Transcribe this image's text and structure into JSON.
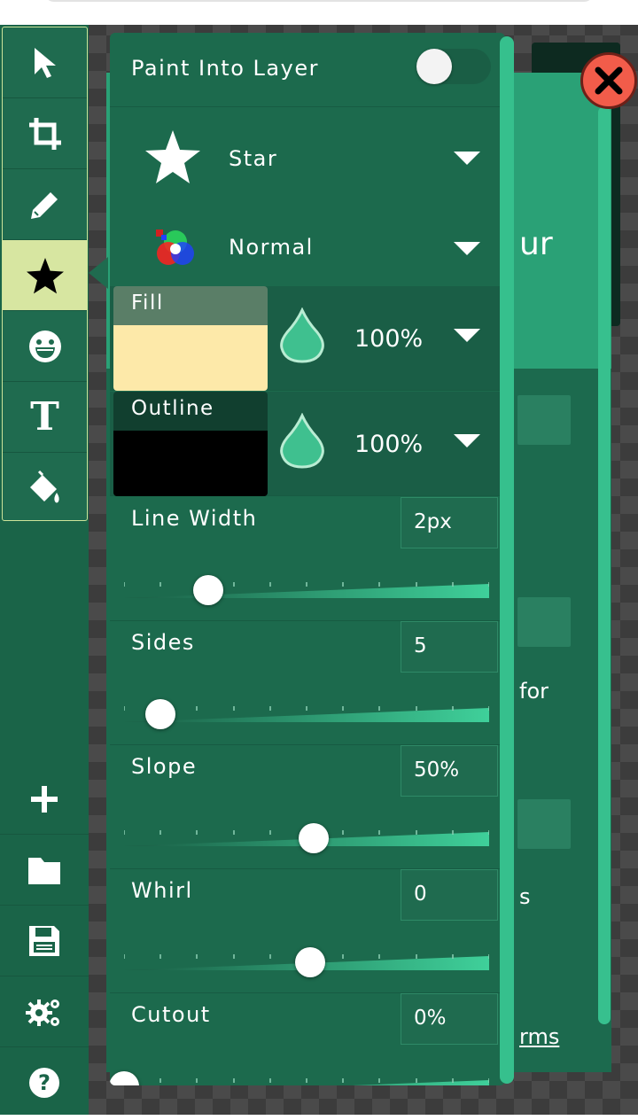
{
  "toolbar": {
    "tools": [
      {
        "icon": "select-arrow-icon"
      },
      {
        "icon": "crop-icon"
      },
      {
        "icon": "pencil-icon"
      },
      {
        "icon": "star-icon",
        "active": true
      },
      {
        "icon": "emoji-icon"
      },
      {
        "icon": "text-icon",
        "glyph": "T"
      },
      {
        "icon": "paint-bucket-icon"
      }
    ],
    "bottom": [
      {
        "icon": "add-icon"
      },
      {
        "icon": "folder-icon"
      },
      {
        "icon": "save-icon"
      },
      {
        "icon": "settings-icon"
      },
      {
        "icon": "help-icon",
        "glyph": "?"
      }
    ]
  },
  "panel": {
    "paint_into_layer": {
      "label": "Paint Into Layer",
      "enabled": false
    },
    "shape": {
      "label": "Star",
      "icon": "star-icon"
    },
    "blend_mode": {
      "label": "Normal",
      "icon": "color-blend-icon"
    },
    "fill": {
      "label": "Fill",
      "color": "#fde9a9",
      "opacity": "100%"
    },
    "outline": {
      "label": "Outline",
      "color": "#000000",
      "opacity": "100%"
    },
    "line_width": {
      "label": "Line Width",
      "value": "2px",
      "slider_fraction": 0.23
    },
    "sides": {
      "label": "Sides",
      "value": "5",
      "slider_fraction": 0.1
    },
    "slope": {
      "label": "Slope",
      "value": "50%",
      "slider_fraction": 0.52
    },
    "whirl": {
      "label": "Whirl",
      "value": "0",
      "slider_fraction": 0.51
    },
    "cutout": {
      "label": "Cutout",
      "value": "0%",
      "slider_fraction": 0.0
    }
  },
  "background_dialog": {
    "fragments": [
      "ur",
      "for",
      "s",
      "rms"
    ]
  },
  "colors": {
    "accent": "#36c08d",
    "panel": "#1c6a4d",
    "active_tool": "#d7e6a1",
    "close": "#f25c4a"
  }
}
